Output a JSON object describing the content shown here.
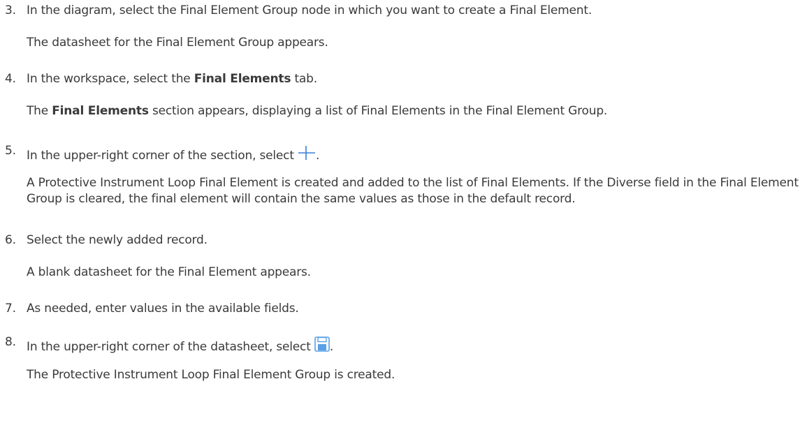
{
  "steps": [
    {
      "number": "3.",
      "text": "In the diagram, select the Final Element Group node in which you want to create a Final Element.",
      "result": "The datasheet for the Final Element Group appears."
    },
    {
      "number": "4.",
      "text_before": "In the workspace, select the ",
      "text_bold": "Final Elements",
      "text_after": " tab.",
      "result_bold": "Final Elements",
      "result_after": " section appears, displaying a list of Final Elements in the Final Element Group.",
      "result_before": "The "
    },
    {
      "number": "5.",
      "text_before": "In the upper-right corner of the section, select ",
      "icon": "plus-icon",
      "text_after": ".",
      "result": "A Protective Instrument Loop Final Element is created and added to the list of Final Elements. If the Diverse field in the Final Element Group is cleared, the final element will contain the same values as those in the default record."
    },
    {
      "number": "6.",
      "text": "Select the newly added record.",
      "result": "A blank datasheet for the Final Element appears."
    },
    {
      "number": "7.",
      "text": "As needed, enter values in the available fields."
    },
    {
      "number": "8.",
      "text_before": "In the upper-right corner of the datasheet, select ",
      "icon": "save-icon",
      "text_after": ".",
      "result": "The Protective Instrument Loop Final Element Group is created."
    }
  ],
  "colors": {
    "text": "#3a3a3a",
    "plus_icon": "#3b7fd9",
    "save_icon": "#5aa0e6"
  }
}
